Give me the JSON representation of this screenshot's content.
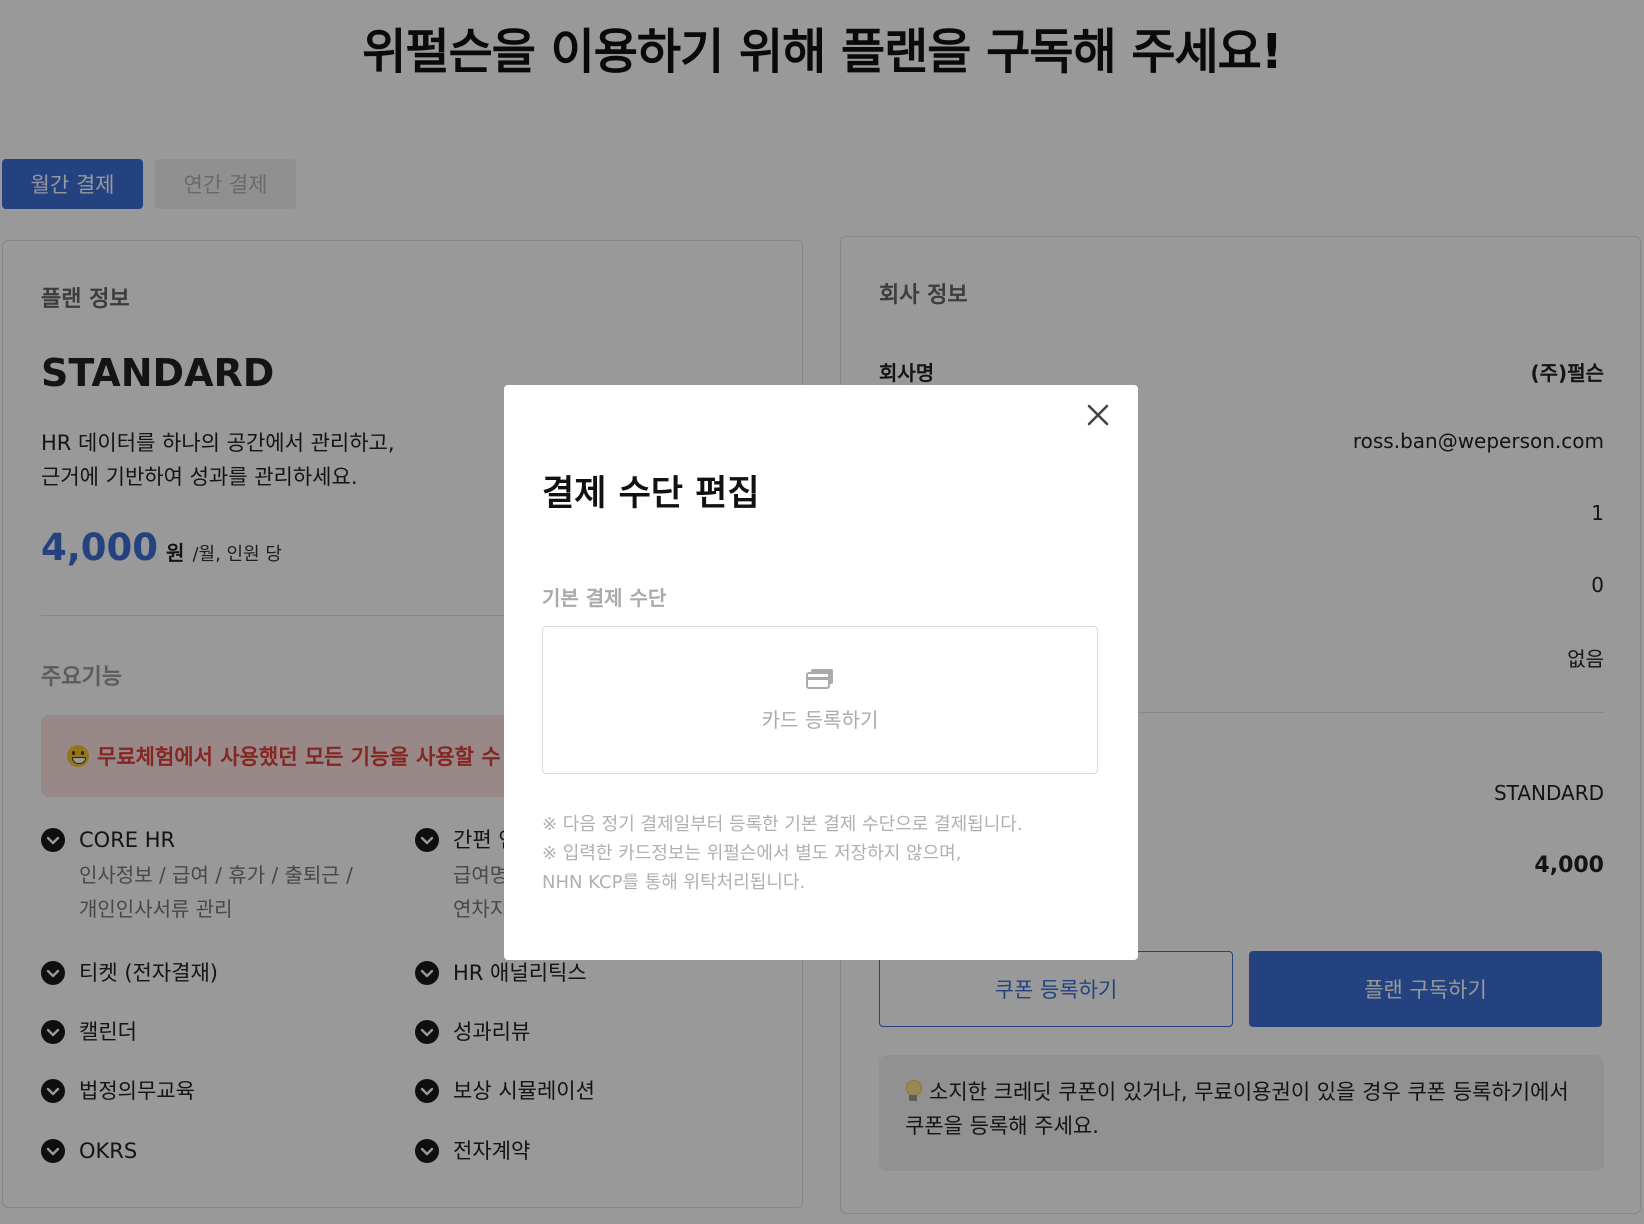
{
  "page_title": "위펄슨을 이용하기 위해 플랜을 구독해 주세요!",
  "tabs": [
    "월간 결제",
    "연간 결제"
  ],
  "plan": {
    "section_label": "플랜 정보",
    "name": "STANDARD",
    "description": "HR 데이터를 하나의 공간에서 관리하고,\n근거에 기반하여 성과를 관리하세요.",
    "price": "4,000",
    "currency": "원",
    "per": "/월, 인원 당",
    "features_label": "주요기능",
    "notice": "무료체험에서 사용했던 모든 기능을 사용할 수 있",
    "features": [
      {
        "title": "CORE HR",
        "sub": "인사정보 / 급여 / 휴가 / 출퇴근 /\n개인인사서류 관리"
      },
      {
        "title": "간편 연",
        "sub": "급여명\n연차지"
      },
      {
        "title": "티켓 (전자결재)",
        "sub": ""
      },
      {
        "title": "HR 애널리틱스",
        "sub": ""
      },
      {
        "title": "캘린더",
        "sub": ""
      },
      {
        "title": "성과리뷰",
        "sub": ""
      },
      {
        "title": "법정의무교육",
        "sub": ""
      },
      {
        "title": "보상 시뮬레이션",
        "sub": ""
      },
      {
        "title": "OKRS",
        "sub": ""
      },
      {
        "title": "전자계약",
        "sub": ""
      }
    ]
  },
  "company": {
    "section_label": "회사 정보",
    "name_key": "회사명",
    "name_value": "(주)펄슨",
    "email": "ross.ban@weperson.com",
    "value_1": "1",
    "value_2": "0",
    "value_3": "없음",
    "plan_value": "STANDARD",
    "amount_value": "4,000",
    "coupon_button": "쿠폰 등록하기",
    "subscribe_button": "플랜 구독하기",
    "coupon_note": "소지한 크레딧 쿠폰이 있거나, 무료이용권이 있을 경우 쿠폰 등록하기에서 쿠폰을 등록해 주세요."
  },
  "modal": {
    "title": "결제 수단 편집",
    "label": "기본 결제 수단",
    "card_button": "카드 등록하기",
    "note_1": "※ 다음 정기 결제일부터 등록한 기본 결제 수단으로 결제됩니다.",
    "note_2": "※ 입력한 카드정보는 위펄슨에서 별도 저장하지 않으며,",
    "note_3": "NHN KCP를 통해 위탁처리됩니다."
  },
  "colors": {
    "accent": "#3b6fd4",
    "notice_bg": "#fde3e3",
    "notice_text": "#e0403a"
  }
}
